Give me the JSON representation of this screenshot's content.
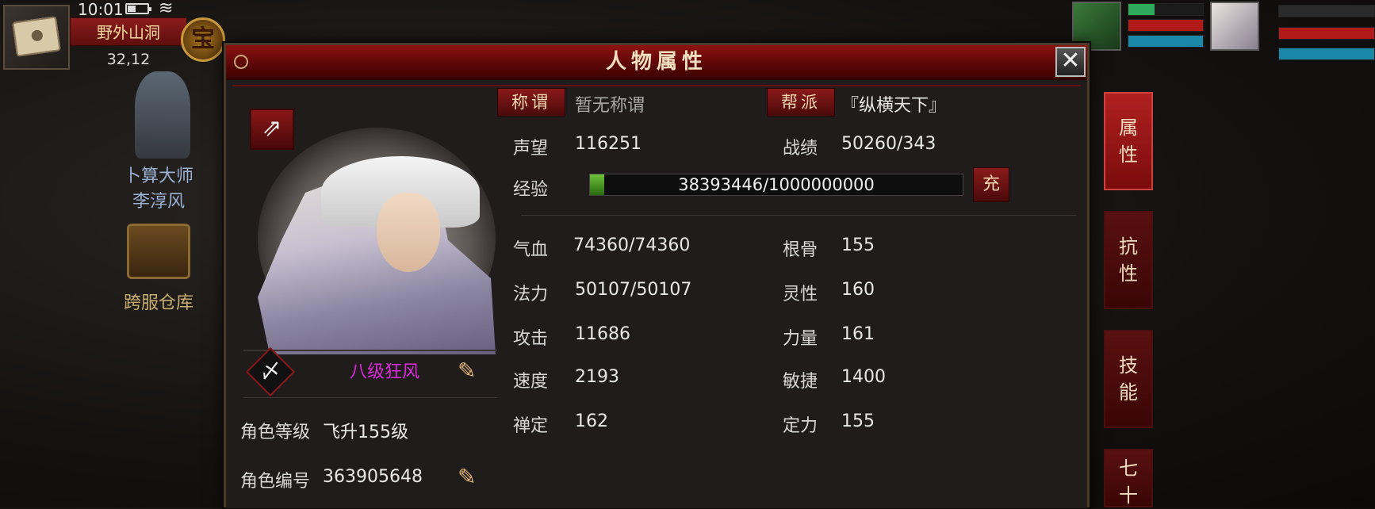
{
  "hud": {
    "time": "10:01",
    "location": "野外山洞",
    "coords": "32,12",
    "treasure_label": "宝"
  },
  "npcs": [
    {
      "line1": "卜算大师",
      "line2": "李淳风"
    },
    {
      "line1": "跨服仓库"
    }
  ],
  "panel": {
    "title": "人物属性",
    "close": "✕",
    "title_btn": "称谓",
    "title_value": "暂无称谓",
    "guild_btn": "帮派",
    "guild_value": "『纵横天下』",
    "sect_icon": "〆",
    "sect_name": "八级狂风",
    "level_label": "角色等级",
    "level_value": "飞升155级",
    "id_label": "角色编号",
    "id_value": "363905648",
    "reputation_label": "声望",
    "reputation_value": "116251",
    "record_label": "战绩",
    "record_value": "50260/343",
    "exp_label": "经验",
    "exp_value": "38393446/1000000000",
    "exp_progress": 0.038,
    "charge_btn": "充",
    "stats_left": [
      {
        "label": "气血",
        "value": "74360/74360"
      },
      {
        "label": "法力",
        "value": "50107/50107"
      },
      {
        "label": "攻击",
        "value": "11686"
      },
      {
        "label": "速度",
        "value": "2193"
      },
      {
        "label": "禅定",
        "value": "162"
      }
    ],
    "stats_right": [
      {
        "label": "根骨",
        "value": "155"
      },
      {
        "label": "灵性",
        "value": "160"
      },
      {
        "label": "力量",
        "value": "161"
      },
      {
        "label": "敏捷",
        "value": "1400"
      },
      {
        "label": "定力",
        "value": "155"
      }
    ]
  },
  "side_tabs": [
    {
      "line1": "属",
      "line2": "性"
    },
    {
      "line1": "抗",
      "line2": "性"
    },
    {
      "line1": "技",
      "line2": "能"
    },
    {
      "line1": "七",
      "line2": "十"
    }
  ],
  "party": {
    "member1_hp": 0.35,
    "member2_hp": 1.0
  },
  "colors": {
    "accent_red": "#8a1a1a",
    "sect_name_color": "#d82ad8",
    "exp_fill": "#6ec23a"
  }
}
